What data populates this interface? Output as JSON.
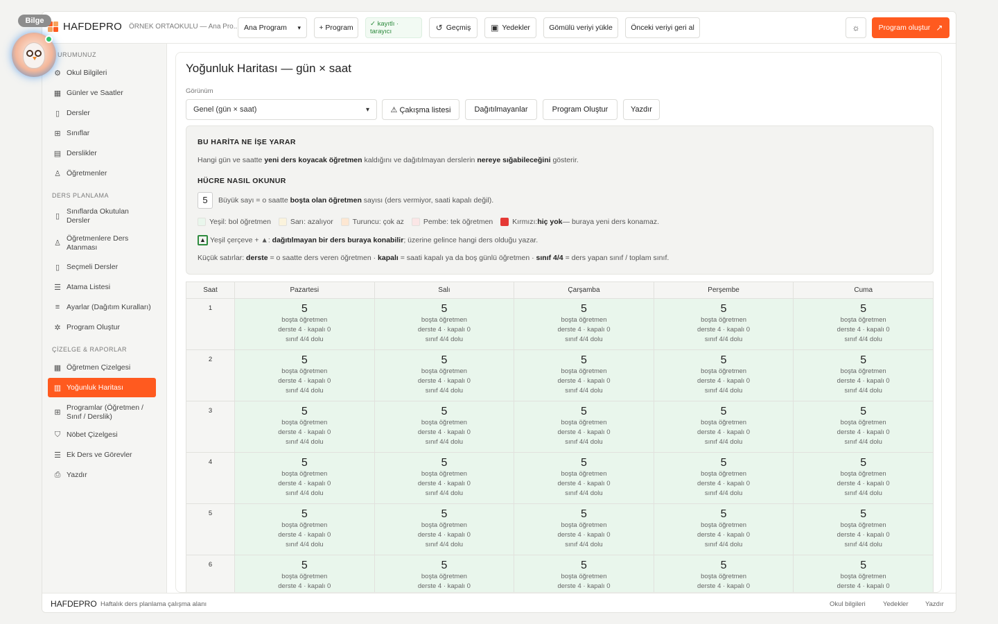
{
  "app": {
    "brand": "HAFDEPRO",
    "school": "ÖRNEK ORTAOKULU — Ana Pro...",
    "colors": {
      "accent": "#ff5a1f",
      "cell_fill": "#e9f6ec",
      "ok": "#2e8b3e",
      "red": "#e53935"
    }
  },
  "toolbar": {
    "program_select": "Ana Program",
    "new_program": "+ Program",
    "status": "✓ kayıtlı · tarayıcı",
    "history": "Geçmiş",
    "backups": "Yedekler",
    "load_embedded": "Gömülü veriyi yükle",
    "restore_previous": "Önceki veriyi geri al",
    "create_program": "Program oluştur"
  },
  "assistant": {
    "name": "Bilge"
  },
  "sidebar": {
    "section1": "URUMUNUZ",
    "items1": [
      {
        "label": "Okul Bilgileri",
        "icon": "settings-icon"
      },
      {
        "label": "Günler ve Saatler",
        "icon": "calendar-icon"
      },
      {
        "label": "Dersler",
        "icon": "book-icon"
      },
      {
        "label": "Sınıflar",
        "icon": "grid-icon"
      },
      {
        "label": "Derslikler",
        "icon": "room-icon"
      },
      {
        "label": "Öğretmenler",
        "icon": "user-icon"
      }
    ],
    "section2": "DERS PLANLAMA",
    "items2": [
      {
        "label": "Sınıflarda Okutulan Dersler",
        "icon": "book-icon"
      },
      {
        "label": "Öğretmenlere Ders Atanması",
        "icon": "user-icon"
      },
      {
        "label": "Seçmeli Dersler",
        "icon": "book-icon"
      },
      {
        "label": "Atama Listesi",
        "icon": "list-icon"
      },
      {
        "label": "Ayarlar (Dağıtım Kuralları)",
        "icon": "sliders-icon"
      },
      {
        "label": "Program Oluştur",
        "icon": "gear-icon"
      }
    ],
    "section3": "ÇİZELGE & RAPORLAR",
    "items3": [
      {
        "label": "Öğretmen Çizelgesi",
        "icon": "calendar-icon"
      },
      {
        "label": "Yoğunluk Haritası",
        "icon": "chart-icon",
        "active": true
      },
      {
        "label": "Programlar (Öğretmen / Sınıf / Derslik)",
        "icon": "grid-icon"
      },
      {
        "label": "Nöbet Çizelgesi",
        "icon": "shield-icon"
      },
      {
        "label": "Ek Ders ve Görevler",
        "icon": "list-icon"
      },
      {
        "label": "Yazdır",
        "icon": "printer-icon"
      }
    ]
  },
  "main": {
    "title": "Yoğunluk Haritası — gün × saat",
    "view_label": "Görünüm",
    "view_select": "Genel (gün × saat)",
    "actions": {
      "conflicts": "⚠ Çakışma listesi",
      "undistributed": "Dağıtılmayanlar",
      "create": "Program Oluştur",
      "print": "Yazdır"
    },
    "info": {
      "h1": "BU HARİTA NE İŞE YARAR",
      "p1a": "Hangi gün ve saatte ",
      "p1b": "yeni ders koyacak öğretmen",
      "p1c": " kaldığını ve dağıtılmayan derslerin ",
      "p1d": "nereye sığabileceğini",
      "p1e": " gösterir.",
      "h2": "HÜCRE NASIL OKUNUR",
      "sample_number": "5",
      "p2a": "Büyük sayı = o saatte ",
      "p2b": "boşta olan öğretmen",
      "p2c": " sayısı (ders vermiyor, saati kapalı değil).",
      "legend": [
        {
          "label": "Yeşil: bol öğretmen",
          "color": "#e9f6ec"
        },
        {
          "label": "Sarı: azalıyor",
          "color": "#fbf3dc"
        },
        {
          "label": "Turuncu: çok az",
          "color": "#fde7d2"
        },
        {
          "label": "Pembe: tek öğretmen",
          "color": "#fbe6e6"
        }
      ],
      "red_prefix": "Kırmızı: ",
      "red_bold": "hiç yok",
      "red_suffix": " — buraya yeni ders konamaz.",
      "p3a": "Yeşil çerçeve + ▲: ",
      "p3b": "dağıtılmayan bir ders buraya konabilir",
      "p3c": "; üzerine gelince hangi ders olduğu yazar.",
      "p4a": "Küçük satırlar: ",
      "p4b": "derste",
      "p4c": " = o saatte ders veren öğretmen · ",
      "p4d": "kapalı",
      "p4e": " = saati kapalı ya da boş günlü öğretmen · ",
      "p4f": "sınıf 4/4",
      "p4g": " = ders yapan sınıf / toplam sınıf."
    },
    "grid": {
      "hour_header": "Saat",
      "days": [
        "Pazartesi",
        "Salı",
        "Çarşamba",
        "Perşembe",
        "Cuma"
      ],
      "hours": [
        "1",
        "2",
        "3",
        "4",
        "5",
        "6"
      ],
      "cell": {
        "free": "5",
        "free_label": "boşta öğretmen",
        "busy_line": "derste 4 · kapalı 0",
        "class_line": "sınıf 4/4 dolu"
      }
    }
  },
  "footer": {
    "brand": "HAFDEPRO",
    "desc": "Haftalık ders planlama çalışma alanı",
    "links": [
      "Okul bilgileri",
      "Yedekler",
      "Yazdır"
    ]
  }
}
